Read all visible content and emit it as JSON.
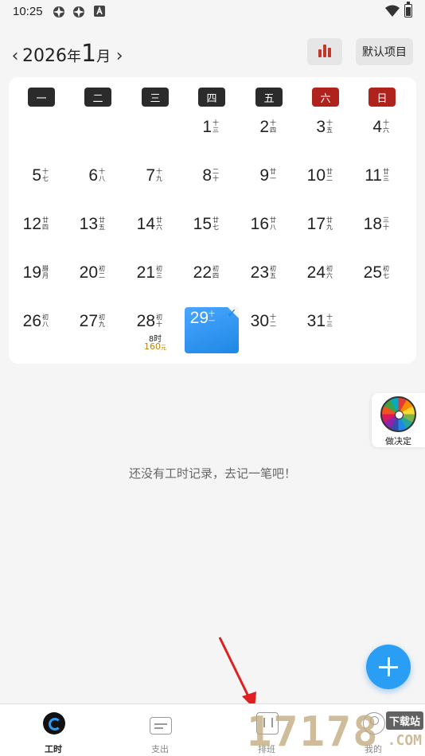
{
  "status_bar": {
    "time": "10:25",
    "icons": [
      "app-icon",
      "app-icon",
      "a-icon",
      "wifi-icon",
      "battery-icon"
    ]
  },
  "header": {
    "prev_icon": "‹",
    "year": "2026",
    "year_unit": "年",
    "month": "1",
    "month_unit": "月",
    "next_icon": "›",
    "stats_icon": "bar-chart-icon",
    "project_button": "默认项目"
  },
  "calendar": {
    "weekdays": [
      "一",
      "二",
      "三",
      "四",
      "五",
      "六",
      "日"
    ],
    "weekend_color": "#b0231c",
    "days": [
      {
        "day": "1",
        "lunar": "十三"
      },
      {
        "day": "2",
        "lunar": "十四"
      },
      {
        "day": "3",
        "lunar": "十五"
      },
      {
        "day": "4",
        "lunar": "十六"
      },
      {
        "day": "5",
        "lunar": "十七"
      },
      {
        "day": "6",
        "lunar": "十八"
      },
      {
        "day": "7",
        "lunar": "十九"
      },
      {
        "day": "8",
        "lunar": "二十"
      },
      {
        "day": "9",
        "lunar": "廿一"
      },
      {
        "day": "10",
        "lunar": "廿二"
      },
      {
        "day": "11",
        "lunar": "廿三"
      },
      {
        "day": "12",
        "lunar": "廿四"
      },
      {
        "day": "13",
        "lunar": "廿五"
      },
      {
        "day": "14",
        "lunar": "廿六"
      },
      {
        "day": "15",
        "lunar": "廿七"
      },
      {
        "day": "16",
        "lunar": "廿八"
      },
      {
        "day": "17",
        "lunar": "廿九"
      },
      {
        "day": "18",
        "lunar": "三十"
      },
      {
        "day": "19",
        "lunar": "腊月"
      },
      {
        "day": "20",
        "lunar": "初二"
      },
      {
        "day": "21",
        "lunar": "初三"
      },
      {
        "day": "22",
        "lunar": "初四"
      },
      {
        "day": "23",
        "lunar": "初五"
      },
      {
        "day": "24",
        "lunar": "初六"
      },
      {
        "day": "25",
        "lunar": "初七"
      },
      {
        "day": "26",
        "lunar": "初八"
      },
      {
        "day": "27",
        "lunar": "初九"
      },
      {
        "day": "28",
        "lunar": "初十",
        "hours": "8时",
        "amount": "160",
        "amount_unit": "元"
      },
      {
        "day": "29",
        "lunar": "十一",
        "selected": true
      },
      {
        "day": "30",
        "lunar": "十二"
      },
      {
        "day": "31",
        "lunar": "十三"
      }
    ],
    "first_weekday_index": 3,
    "selected_color": "#1e88e5",
    "amount_color": "#b8860b"
  },
  "decide": {
    "label": "做决定",
    "icon": "spin-wheel-icon"
  },
  "empty_message": "还没有工时记录，去记一笔吧！",
  "fab_icon": "plus-icon",
  "bottom_nav": {
    "tabs": [
      {
        "label": "工时",
        "icon": "worktime-icon",
        "active": true
      },
      {
        "label": "支出",
        "icon": "expense-icon",
        "active": false
      },
      {
        "label": "排班",
        "icon": "schedule-icon",
        "active": false
      },
      {
        "label": "我的",
        "icon": "mine-icon",
        "active": false
      }
    ]
  },
  "watermark": {
    "digits": "1717",
    "digits2": "8",
    "site": "下载站",
    "domain": ".COM"
  }
}
